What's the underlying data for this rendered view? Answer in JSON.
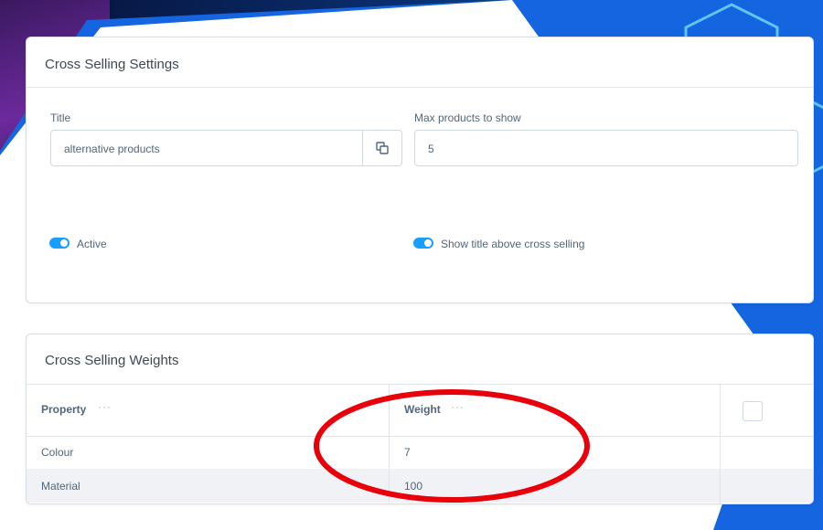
{
  "settings": {
    "title": "Cross Selling Settings",
    "title_label": "Title",
    "title_value": "alternative products",
    "max_label": "Max products to show",
    "max_value": "5",
    "active_label": "Active",
    "active_on": true,
    "show_title_label": "Show title above cross selling",
    "show_title_on": true
  },
  "weights": {
    "title": "Cross Selling Weights",
    "columns": [
      "Property",
      "Weight"
    ],
    "more_glyph": "···",
    "rows": [
      {
        "property": "Colour",
        "weight": "7"
      },
      {
        "property": "Material",
        "weight": "100"
      }
    ]
  },
  "colors": {
    "accent": "#189eff",
    "annotation": "#e8000b"
  },
  "icons": {
    "copy": "copy-icon",
    "more": "more-options-icon"
  }
}
